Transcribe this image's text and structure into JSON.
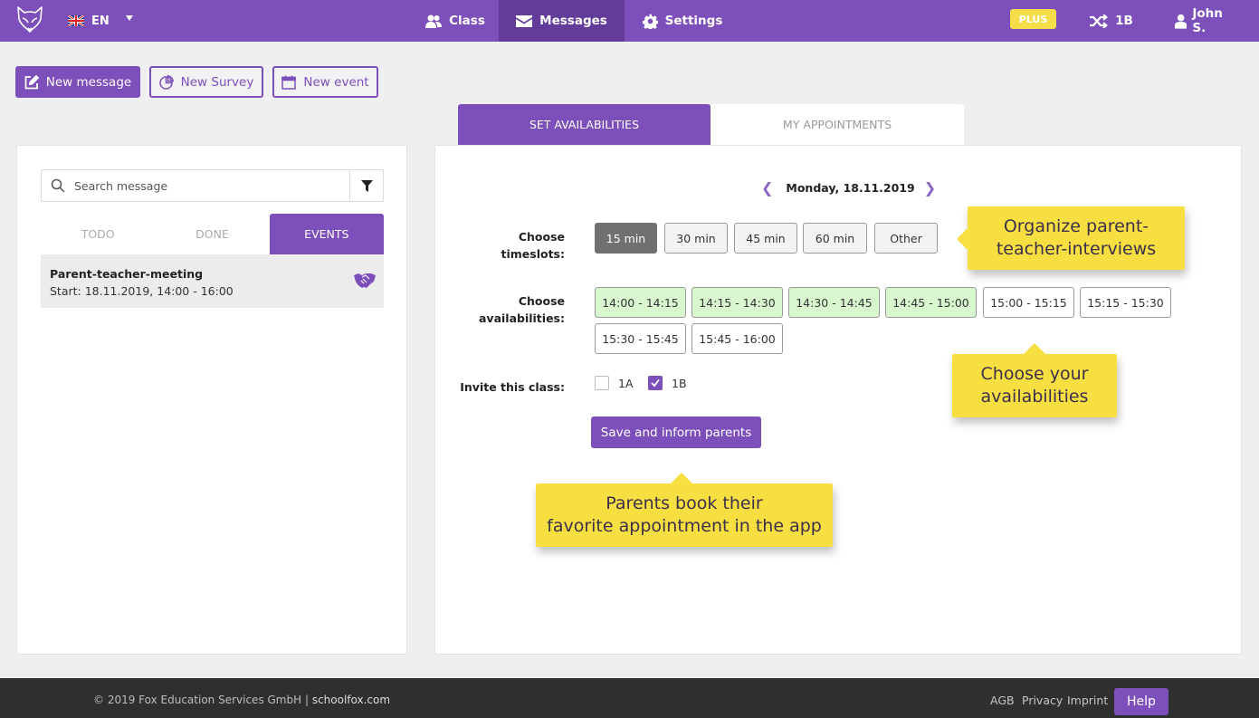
{
  "topbar": {
    "language": "EN",
    "nav": [
      {
        "label": "Class",
        "icon": "users-icon",
        "active": false
      },
      {
        "label": "Messages",
        "icon": "envelope-icon",
        "active": true
      },
      {
        "label": "Settings",
        "icon": "gear-icon",
        "active": false
      }
    ],
    "plus_badge": "PLUS",
    "class_switch": "1B",
    "user": "John S."
  },
  "actions": {
    "new_message": "New message",
    "new_survey": "New Survey",
    "new_event": "New event"
  },
  "left": {
    "search_placeholder": "Search message",
    "tabs": [
      {
        "label": "TODO",
        "active": false
      },
      {
        "label": "DONE",
        "active": false
      },
      {
        "label": "EVENTS",
        "active": true
      }
    ],
    "events": [
      {
        "title": "Parent-teacher-meeting",
        "subtitle": "Start: 18.11.2019, 14:00 - 16:00",
        "icon": "handshake-icon"
      }
    ]
  },
  "main": {
    "tabs": [
      {
        "label": "SET AVAILABILITIES",
        "active": true
      },
      {
        "label": "MY APPOINTMENTS",
        "active": false
      }
    ],
    "date": "Monday, 18.11.2019",
    "timeslots_label_1": "Choose",
    "timeslots_label_2": "timeslots:",
    "timeslots": [
      {
        "label": "15 min",
        "selected": true
      },
      {
        "label": "30 min",
        "selected": false
      },
      {
        "label": "45 min",
        "selected": false
      },
      {
        "label": "60 min",
        "selected": false
      },
      {
        "label": "Other",
        "selected": false
      }
    ],
    "avail_label_1": "Choose",
    "avail_label_2": "availabilities:",
    "availabilities": [
      {
        "label": "14:00 - 14:15",
        "selected": true
      },
      {
        "label": "14:15 - 14:30",
        "selected": true
      },
      {
        "label": "14:30 - 14:45",
        "selected": true
      },
      {
        "label": "14:45 - 15:00",
        "selected": true
      },
      {
        "label": "15:00 - 15:15",
        "selected": false
      },
      {
        "label": "15:15 - 15:30",
        "selected": false
      },
      {
        "label": "15:30 - 15:45",
        "selected": false
      },
      {
        "label": "15:45 - 16:00",
        "selected": false
      }
    ],
    "invite_label": "Invite this class:",
    "classes": [
      {
        "label": "1A",
        "checked": false
      },
      {
        "label": "1B",
        "checked": true
      }
    ],
    "save_button": "Save and inform parents"
  },
  "callouts": {
    "organize_1": "Organize parent-",
    "organize_2": "teacher-interviews",
    "choose_1": "Choose your",
    "choose_2": "availabilities",
    "parents_1": "Parents book their",
    "parents_2": "favorite appointment in the app"
  },
  "footer": {
    "copyright": "© 2019 Fox Education Services GmbH |",
    "site": "schoolfox.com",
    "links": [
      "AGB",
      "Privacy",
      "Imprint"
    ],
    "help": "Help"
  },
  "colors": {
    "brand": "#7d4fba",
    "brand_dark": "#633c99",
    "plus": "#f4dd48",
    "callout": "#f7df41",
    "slot_selected": "#707070",
    "avail_selected": "#d8f7cf",
    "footer": "#2f2f2f"
  }
}
